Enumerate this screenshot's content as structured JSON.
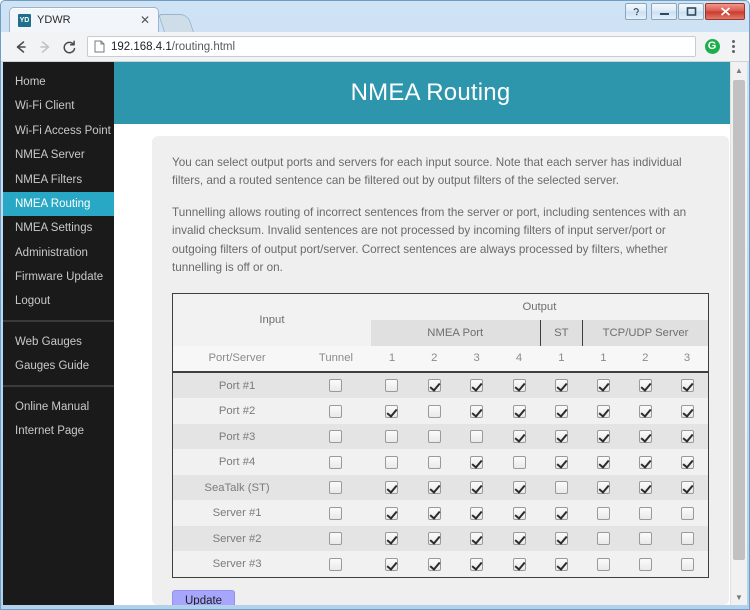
{
  "window": {
    "controls": {
      "help_label": "?",
      "minimize_label": "—",
      "maximize_label": "□",
      "close_label": "✕"
    }
  },
  "browser": {
    "tab": {
      "favicon_label": "YD",
      "title": "YDWR",
      "close_label": "✕"
    },
    "newtab_label": "",
    "toolbar": {
      "back_label": "←",
      "forward_label": "→",
      "reload_label": "C",
      "url_host": "192.168.4.1",
      "url_path": "/routing.html",
      "extension_label": "G",
      "menu_label": "⋮"
    }
  },
  "sidebar": {
    "groups": [
      {
        "items": [
          {
            "label": "Home",
            "active": false
          },
          {
            "label": "Wi-Fi Client",
            "active": false
          },
          {
            "label": "Wi-Fi Access Point",
            "active": false
          },
          {
            "label": "NMEA Server",
            "active": false
          },
          {
            "label": "NMEA Filters",
            "active": false
          },
          {
            "label": "NMEA Routing",
            "active": true
          },
          {
            "label": "NMEA Settings",
            "active": false
          },
          {
            "label": "Administration",
            "active": false
          },
          {
            "label": "Firmware Update",
            "active": false
          },
          {
            "label": "Logout",
            "active": false
          }
        ]
      },
      {
        "items": [
          {
            "label": "Web Gauges",
            "active": false
          },
          {
            "label": "Gauges Guide",
            "active": false
          }
        ]
      },
      {
        "items": [
          {
            "label": "Online Manual",
            "active": false
          },
          {
            "label": "Internet Page",
            "active": false
          }
        ]
      }
    ]
  },
  "main": {
    "title": "NMEA Routing",
    "paragraph1": "You can select output ports and servers for each input source. Note that each server has individual filters, and a routed sentence can be filtered out by output filters of the selected server.",
    "paragraph2": "Tunnelling allows routing of incorrect sentences from the server or port, including sentences with an invalid checksum. Invalid sentences are not processed by incoming filters of input server/port or outgoing filters of output port/server. Correct sentences are always processed by filters, whether tunnelling is off or on.",
    "update_label": "Update"
  },
  "table": {
    "header_input": "Input",
    "header_output": "Output",
    "group_nmea_port": "NMEA Port",
    "group_st": "ST",
    "group_tcp_udp": "TCP/UDP Server",
    "sub_port_server": "Port/Server",
    "sub_tunnel": "Tunnel",
    "sub_nmea": [
      "1",
      "2",
      "3",
      "4"
    ],
    "sub_st": [
      "1"
    ],
    "sub_tcp": [
      "1",
      "2",
      "3"
    ],
    "rows": [
      {
        "label": "Port #1",
        "tunnel": false,
        "nmea": [
          false,
          true,
          true,
          true
        ],
        "st": [
          true
        ],
        "tcp": [
          true,
          true,
          true
        ]
      },
      {
        "label": "Port #2",
        "tunnel": false,
        "nmea": [
          true,
          false,
          true,
          true
        ],
        "st": [
          true
        ],
        "tcp": [
          true,
          true,
          true
        ]
      },
      {
        "label": "Port #3",
        "tunnel": false,
        "nmea": [
          false,
          false,
          false,
          true
        ],
        "st": [
          true
        ],
        "tcp": [
          true,
          true,
          true
        ]
      },
      {
        "label": "Port #4",
        "tunnel": false,
        "nmea": [
          false,
          false,
          true,
          false
        ],
        "st": [
          true
        ],
        "tcp": [
          true,
          true,
          true
        ]
      },
      {
        "label": "SeaTalk (ST)",
        "tunnel": false,
        "nmea": [
          true,
          true,
          true,
          true
        ],
        "st": [
          false
        ],
        "tcp": [
          true,
          true,
          true
        ]
      },
      {
        "label": "Server #1",
        "tunnel": false,
        "nmea": [
          true,
          true,
          true,
          true
        ],
        "st": [
          true
        ],
        "tcp": [
          false,
          false,
          false
        ]
      },
      {
        "label": "Server #2",
        "tunnel": false,
        "nmea": [
          true,
          true,
          true,
          true
        ],
        "st": [
          true
        ],
        "tcp": [
          false,
          false,
          false
        ]
      },
      {
        "label": "Server #3",
        "tunnel": false,
        "nmea": [
          true,
          true,
          true,
          true
        ],
        "st": [
          true
        ],
        "tcp": [
          false,
          false,
          false
        ]
      }
    ]
  },
  "colors": {
    "accent": "#2d96ad",
    "sidebar_active": "#29a8c6",
    "sidebar_bg": "#1a1a1a",
    "button": "#a6a6fc"
  }
}
